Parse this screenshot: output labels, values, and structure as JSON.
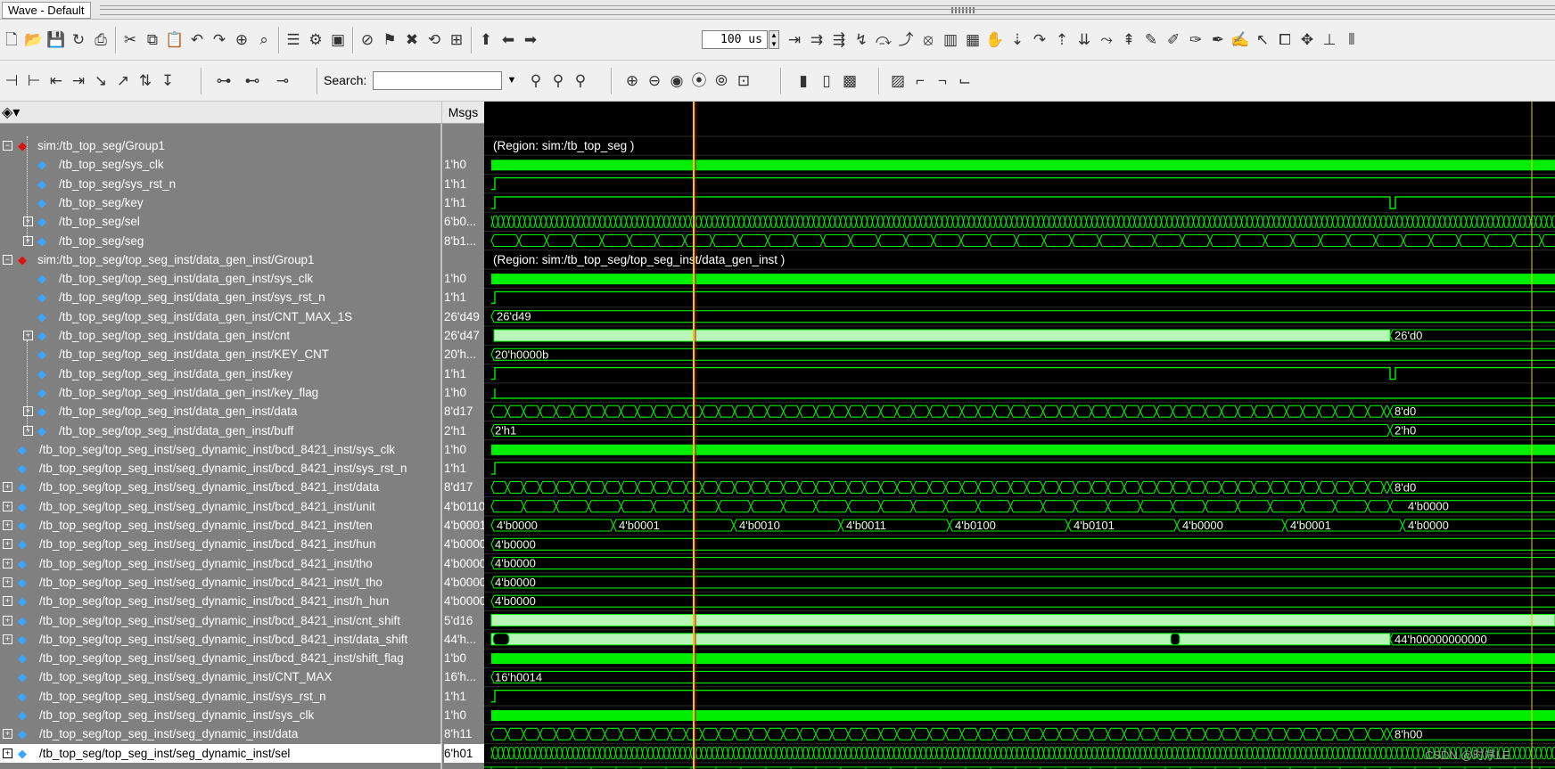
{
  "window": {
    "title": "Wave - Default"
  },
  "toolbar": {
    "time_value": "100 us",
    "search_label": "Search:",
    "search_value": "",
    "icons_row1": [
      "new-icon",
      "open-icon",
      "save-icon",
      "reload-icon",
      "print-icon",
      "cut-icon",
      "copy-icon",
      "paste-icon",
      "undo-icon",
      "redo-icon",
      "add-icon",
      "find-icon",
      "format-icon",
      "compile-icon",
      "simulate-icon",
      "break-icon",
      "dataflow-icon",
      "stop-icon",
      "restart-icon",
      "run-icon",
      "step-up-icon",
      "back-icon",
      "forward-icon",
      "run-length-icon",
      "run-all-icon",
      "continue-icon",
      "step-icon",
      "step-over-icon",
      "step-out-icon",
      "break-run-icon",
      "wave-icon",
      "memory-icon",
      "hand-icon",
      "step-into-icon",
      "step-over2-icon",
      "step-out2-icon",
      "insert-cursor-icon",
      "wave-search-icon",
      "wave-search2-icon",
      "edit-icon",
      "edit2-icon",
      "edit3-icon",
      "edit4-icon",
      "edit5-icon",
      "select-icon",
      "zoom-region-icon",
      "move-icon",
      "measure-icon",
      "compare-icon"
    ],
    "icons_row2": [
      "cursor-left-icon",
      "cursor-right-icon",
      "edge-prev-icon",
      "edge-next-icon",
      "edge-fall-icon",
      "edge-rise-icon",
      "edge-any-icon",
      "edge-last-icon",
      "add-wave-icon",
      "delete-wave-icon",
      "insert-divider-icon",
      "search-binoculars-icon",
      "search-next-icon",
      "search-prev-icon",
      "zoom-in-icon",
      "zoom-out-icon",
      "zoom-full-icon",
      "zoom-cursor-icon",
      "zoom-last-icon",
      "zoom-region2-icon",
      "wave-dark1-icon",
      "wave-dark2-icon",
      "wave-green-icon",
      "wave-gray-icon",
      "wave-step1-icon",
      "wave-step2-icon",
      "wave-step3-icon"
    ]
  },
  "panes": {
    "msgs_header": "Msgs"
  },
  "signals": [
    {
      "name": "sim:/tb_top_seg/Group1",
      "msg": "",
      "kind": "group"
    },
    {
      "name": "/tb_top_seg/sys_clk",
      "msg": "1'h0"
    },
    {
      "name": "/tb_top_seg/sys_rst_n",
      "msg": "1'h1"
    },
    {
      "name": "/tb_top_seg/key",
      "msg": "1'h1"
    },
    {
      "name": "/tb_top_seg/sel",
      "msg": "6'b0..."
    },
    {
      "name": "/tb_top_seg/seg",
      "msg": "8'b1..."
    },
    {
      "name": "sim:/tb_top_seg/top_seg_inst/data_gen_inst/Group1",
      "msg": "",
      "kind": "group"
    },
    {
      "name": "/tb_top_seg/top_seg_inst/data_gen_inst/sys_clk",
      "msg": "1'h0"
    },
    {
      "name": "/tb_top_seg/top_seg_inst/data_gen_inst/sys_rst_n",
      "msg": "1'h1"
    },
    {
      "name": "/tb_top_seg/top_seg_inst/data_gen_inst/CNT_MAX_1S",
      "msg": "26'd49"
    },
    {
      "name": "/tb_top_seg/top_seg_inst/data_gen_inst/cnt",
      "msg": "26'd47"
    },
    {
      "name": "/tb_top_seg/top_seg_inst/data_gen_inst/KEY_CNT",
      "msg": "20'h..."
    },
    {
      "name": "/tb_top_seg/top_seg_inst/data_gen_inst/key",
      "msg": "1'h1"
    },
    {
      "name": "/tb_top_seg/top_seg_inst/data_gen_inst/key_flag",
      "msg": "1'h0"
    },
    {
      "name": "/tb_top_seg/top_seg_inst/data_gen_inst/data",
      "msg": "8'd17"
    },
    {
      "name": "/tb_top_seg/top_seg_inst/data_gen_inst/buff",
      "msg": "2'h1"
    },
    {
      "name": "/tb_top_seg/top_seg_inst/seg_dynamic_inst/bcd_8421_inst/sys_clk",
      "msg": "1'h0"
    },
    {
      "name": "/tb_top_seg/top_seg_inst/seg_dynamic_inst/bcd_8421_inst/sys_rst_n",
      "msg": "1'h1"
    },
    {
      "name": "/tb_top_seg/top_seg_inst/seg_dynamic_inst/bcd_8421_inst/data",
      "msg": "8'd17"
    },
    {
      "name": "/tb_top_seg/top_seg_inst/seg_dynamic_inst/bcd_8421_inst/unit",
      "msg": "4'b0110"
    },
    {
      "name": "/tb_top_seg/top_seg_inst/seg_dynamic_inst/bcd_8421_inst/ten",
      "msg": "4'b0001"
    },
    {
      "name": "/tb_top_seg/top_seg_inst/seg_dynamic_inst/bcd_8421_inst/hun",
      "msg": "4'b0000"
    },
    {
      "name": "/tb_top_seg/top_seg_inst/seg_dynamic_inst/bcd_8421_inst/tho",
      "msg": "4'b0000"
    },
    {
      "name": "/tb_top_seg/top_seg_inst/seg_dynamic_inst/bcd_8421_inst/t_tho",
      "msg": "4'b0000"
    },
    {
      "name": "/tb_top_seg/top_seg_inst/seg_dynamic_inst/bcd_8421_inst/h_hun",
      "msg": "4'b0000"
    },
    {
      "name": "/tb_top_seg/top_seg_inst/seg_dynamic_inst/bcd_8421_inst/cnt_shift",
      "msg": "5'd16"
    },
    {
      "name": "/tb_top_seg/top_seg_inst/seg_dynamic_inst/bcd_8421_inst/data_shift",
      "msg": "44'h..."
    },
    {
      "name": "/tb_top_seg/top_seg_inst/seg_dynamic_inst/bcd_8421_inst/shift_flag",
      "msg": "1'b0"
    },
    {
      "name": "/tb_top_seg/top_seg_inst/seg_dynamic_inst/CNT_MAX",
      "msg": "16'h..."
    },
    {
      "name": "/tb_top_seg/top_seg_inst/seg_dynamic_inst/sys_rst_n",
      "msg": "1'h1"
    },
    {
      "name": "/tb_top_seg/top_seg_inst/seg_dynamic_inst/sys_clk",
      "msg": "1'h0"
    },
    {
      "name": "/tb_top_seg/top_seg_inst/seg_dynamic_inst/data",
      "msg": "8'h11"
    },
    {
      "name": "/tb_top_seg/top_seg_inst/seg_dynamic_inst/sel",
      "msg": "6'h01",
      "selected": true
    }
  ],
  "wave": {
    "region_1": "(Region: sim:/tb_top_seg )",
    "region_2": "(Region: sim:/tb_top_seg/top_seg_inst/data_gen_inst )",
    "cnt_max_1s": "26'd49",
    "cnt_end": "26'd0",
    "key_cnt": "20'h0000b",
    "data_end": "8'd0",
    "buff_start": "2'h1",
    "buff_end": "2'h0",
    "bcd_data_end": "8'd0",
    "unit_end": "4'b0000",
    "ten_values": [
      "4'b0000",
      "4'b0001",
      "4'b0010",
      "4'b0011",
      "4'b0100",
      "4'b0101",
      "4'b0000",
      "4'b0001",
      "4'b0000"
    ],
    "hun": "4'b0000",
    "tho": "4'b0000",
    "t_tho": "4'b0000",
    "h_hun": "4'b0000",
    "data_shift_end": "44'h00000000000",
    "cnt_max": "16'h0014",
    "seg_data_end": "8'h00",
    "watermark": "CSDN @时序LE"
  },
  "colors": {
    "wave_green": "#00ee00",
    "bus_fill": "#b8f5b8",
    "cursor": "#e8d000",
    "cursor2": "#cc0000",
    "pane_gray": "#808080"
  }
}
